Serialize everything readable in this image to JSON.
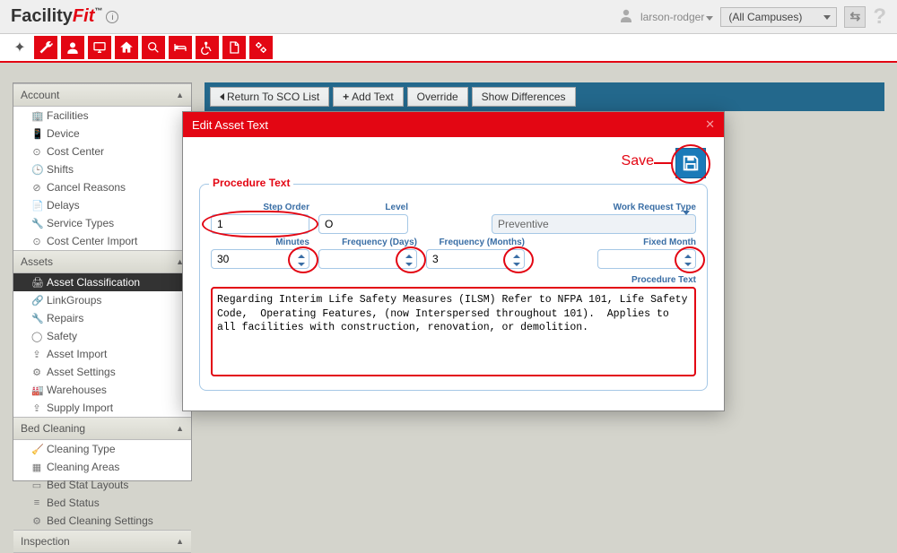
{
  "header": {
    "logo_main": "Facility",
    "logo_accent": "Fit",
    "logo_tm": "™",
    "username": "larson-rodger",
    "campus_selected": "(All Campuses)"
  },
  "sidebar": {
    "sections": [
      {
        "title": "Account",
        "items": [
          {
            "icon": "🏢",
            "label": "Facilities"
          },
          {
            "icon": "📱",
            "label": "Device"
          },
          {
            "icon": "⊙",
            "label": "Cost Center"
          },
          {
            "icon": "🕒",
            "label": "Shifts"
          },
          {
            "icon": "⊘",
            "label": "Cancel Reasons"
          },
          {
            "icon": "📄",
            "label": "Delays"
          },
          {
            "icon": "🔧",
            "label": "Service Types"
          },
          {
            "icon": "⊙",
            "label": "Cost Center Import"
          }
        ]
      },
      {
        "title": "Assets",
        "items": [
          {
            "icon": "🖨",
            "label": "Asset Classification",
            "active": true
          },
          {
            "icon": "🔗",
            "label": "LinkGroups"
          },
          {
            "icon": "🔧",
            "label": "Repairs"
          },
          {
            "icon": "◯",
            "label": "Safety"
          },
          {
            "icon": "⇪",
            "label": "Asset Import"
          },
          {
            "icon": "⚙",
            "label": "Asset Settings"
          },
          {
            "icon": "🏭",
            "label": "Warehouses"
          },
          {
            "icon": "⇪",
            "label": "Supply Import"
          }
        ]
      },
      {
        "title": "Bed Cleaning",
        "items": [
          {
            "icon": "🧹",
            "label": "Cleaning Type"
          },
          {
            "icon": "▦",
            "label": "Cleaning Areas"
          },
          {
            "icon": "▭",
            "label": "Bed Stat Layouts"
          },
          {
            "icon": "≡",
            "label": "Bed Status"
          },
          {
            "icon": "⚙",
            "label": "Bed Cleaning Settings"
          }
        ]
      },
      {
        "title": "Inspection",
        "items": []
      }
    ]
  },
  "tabs": {
    "items": [
      {
        "label": "Return To SCO List",
        "has_back": true
      },
      {
        "label": "Add Text",
        "has_plus": true
      },
      {
        "label": "Override"
      },
      {
        "label": "Show Differences"
      }
    ]
  },
  "dialog": {
    "title": "Edit Asset Text",
    "save_hint": "Save",
    "fieldset_legend": "Procedure Text",
    "labels": {
      "step_order": "Step Order",
      "level": "Level",
      "work_request_type": "Work Request Type",
      "minutes": "Minutes",
      "freq_days": "Frequency (Days)",
      "freq_months": "Frequency (Months)",
      "fixed_month": "Fixed Month",
      "procedure_text": "Procedure Text"
    },
    "values": {
      "step_order": "1",
      "level": "O",
      "work_request_type": "Preventive",
      "minutes": "30",
      "freq_days": "",
      "freq_months": "3",
      "fixed_month": "",
      "procedure_text": "Regarding Interim Life Safety Measures (ILSM) Refer to NFPA 101, Life Safety Code,  Operating Features, (now Interspersed throughout 101).  Applies to all facilities with construction, renovation, or demolition."
    }
  }
}
